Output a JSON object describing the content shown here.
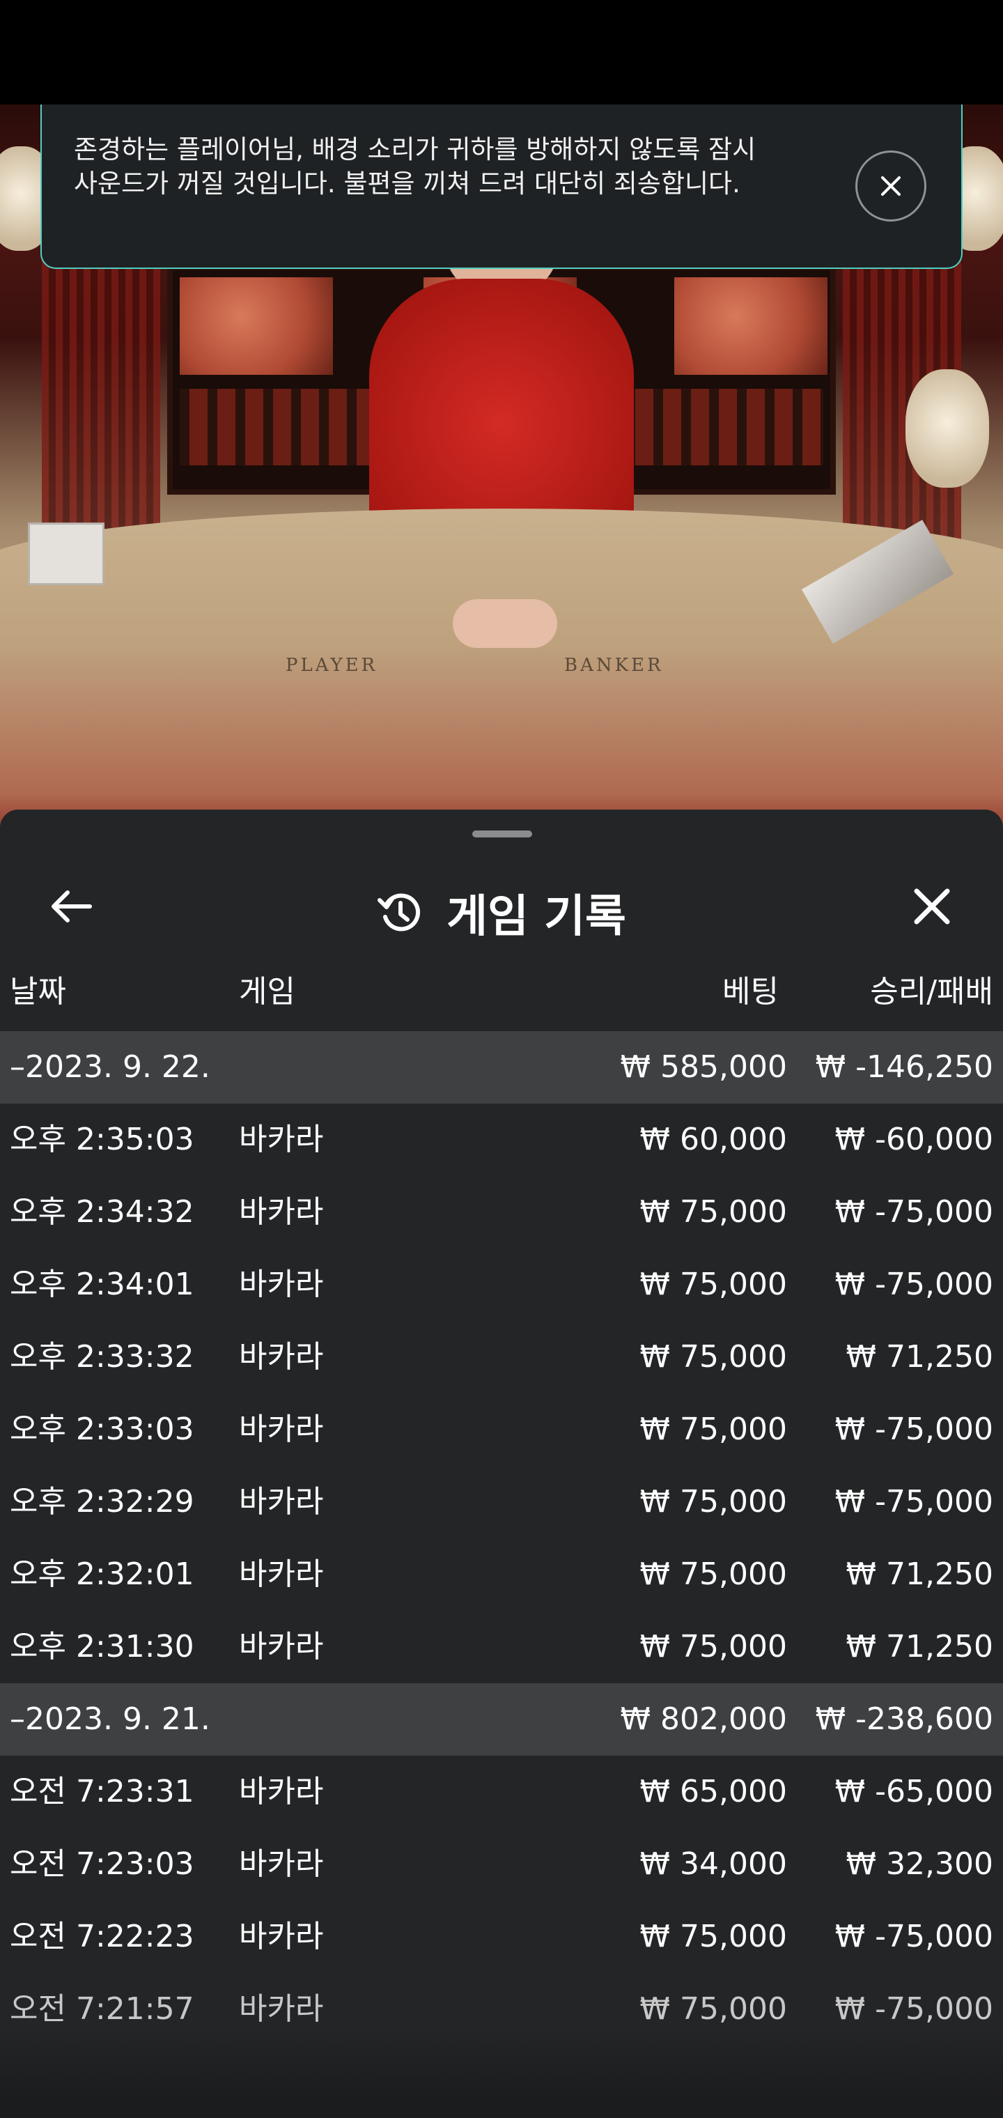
{
  "notice": {
    "message": "존경하는 플레이어님, 배경 소리가 귀하를 방해하지 않도록 잠시 사운드가 꺼질 것입니다. 불편을 끼쳐 드려 대단히 죄송합니다.",
    "accent_color": "#4fd0c4"
  },
  "video": {
    "table_labels": [
      "PLAYER",
      "BANKER"
    ]
  },
  "sheet": {
    "title": "게임 기록",
    "icons": {
      "back": "arrow-left-icon",
      "history": "history-icon",
      "close": "close-icon"
    }
  },
  "columns": {
    "date": "날짜",
    "game": "게임",
    "bet": "베팅",
    "win_loss": "승리/패배"
  },
  "groups": [
    {
      "date": "–2023. 9. 22.",
      "bet_total": "₩ 585,000",
      "win_total": "₩ -146,250",
      "rows": [
        {
          "time": "오후 2:35:03",
          "game": "바카라",
          "bet": "₩ 60,000",
          "result": "₩ -60,000"
        },
        {
          "time": "오후 2:34:32",
          "game": "바카라",
          "bet": "₩ 75,000",
          "result": "₩ -75,000"
        },
        {
          "time": "오후 2:34:01",
          "game": "바카라",
          "bet": "₩ 75,000",
          "result": "₩ -75,000"
        },
        {
          "time": "오후 2:33:32",
          "game": "바카라",
          "bet": "₩ 75,000",
          "result": "₩ 71,250"
        },
        {
          "time": "오후 2:33:03",
          "game": "바카라",
          "bet": "₩ 75,000",
          "result": "₩ -75,000"
        },
        {
          "time": "오후 2:32:29",
          "game": "바카라",
          "bet": "₩ 75,000",
          "result": "₩ -75,000"
        },
        {
          "time": "오후 2:32:01",
          "game": "바카라",
          "bet": "₩ 75,000",
          "result": "₩ 71,250"
        },
        {
          "time": "오후 2:31:30",
          "game": "바카라",
          "bet": "₩ 75,000",
          "result": "₩ 71,250"
        }
      ]
    },
    {
      "date": "–2023. 9. 21.",
      "bet_total": "₩ 802,000",
      "win_total": "₩ -238,600",
      "rows": [
        {
          "time": "오전 7:23:31",
          "game": "바카라",
          "bet": "₩ 65,000",
          "result": "₩ -65,000"
        },
        {
          "time": "오전 7:23:03",
          "game": "바카라",
          "bet": "₩ 34,000",
          "result": "₩ 32,300"
        },
        {
          "time": "오전 7:22:23",
          "game": "바카라",
          "bet": "₩ 75,000",
          "result": "₩ -75,000"
        },
        {
          "time": "오전 7:21:57",
          "game": "바카라",
          "bet": "₩ 75,000",
          "result": "₩ -75,000"
        }
      ]
    }
  ]
}
